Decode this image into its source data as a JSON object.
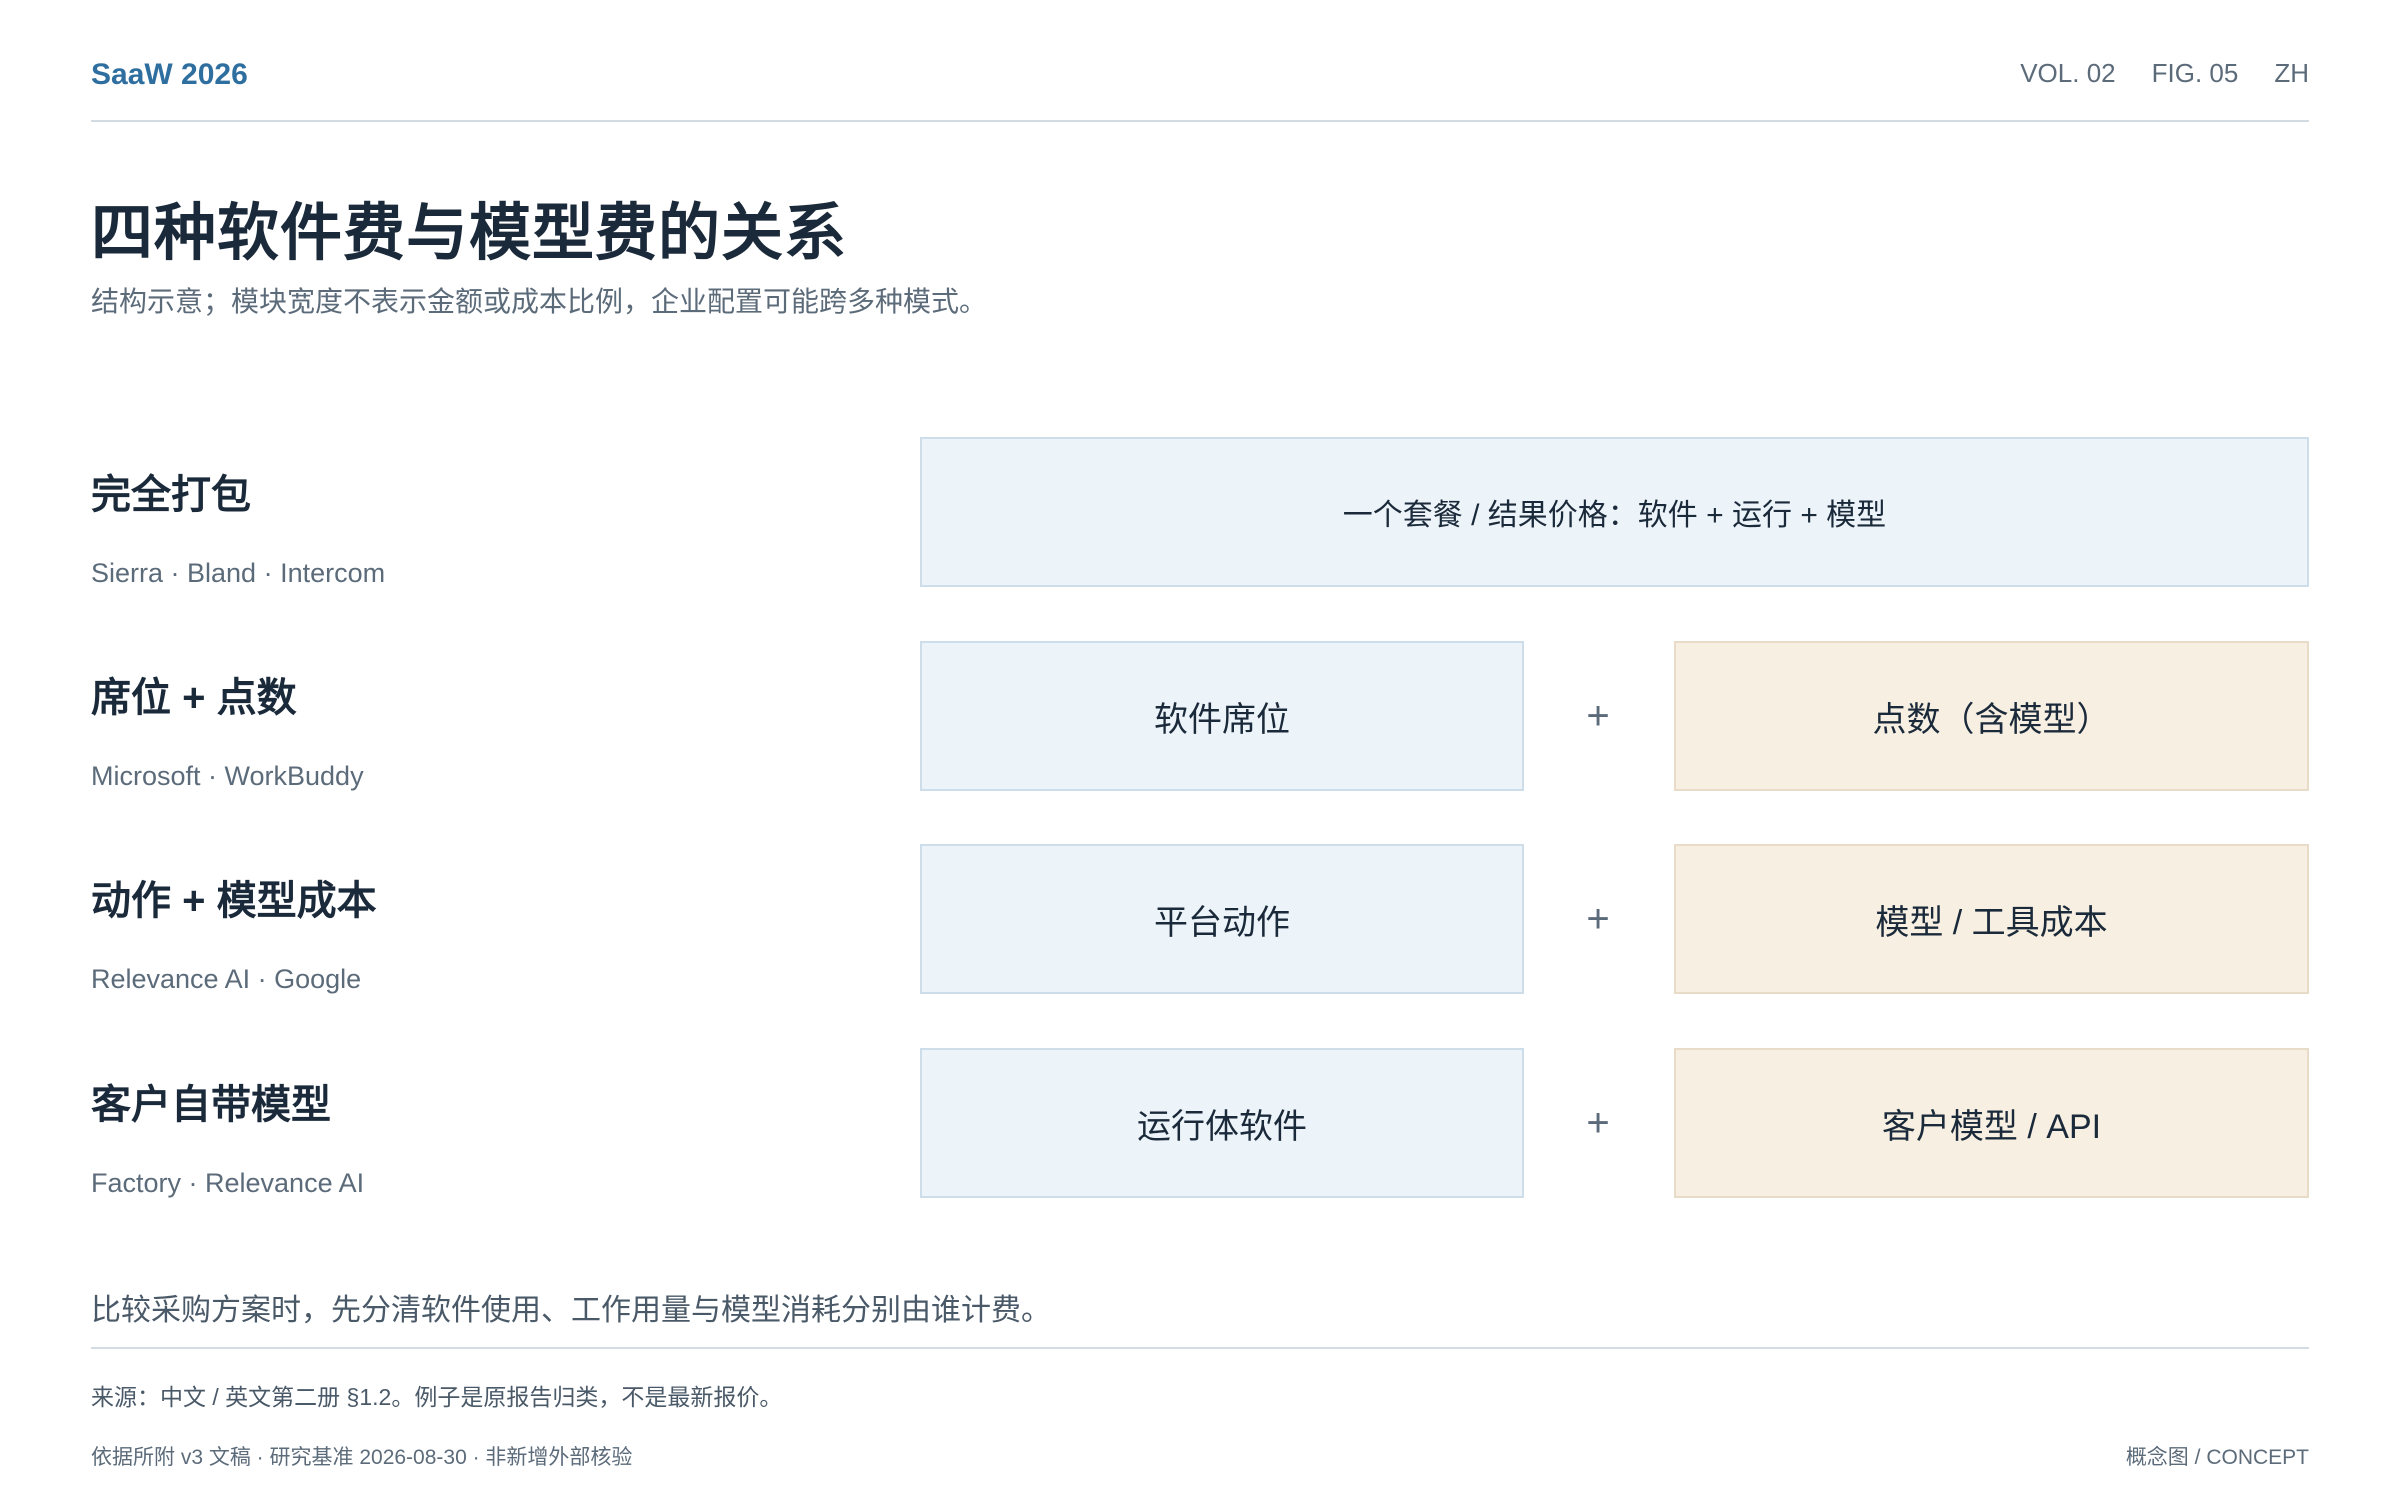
{
  "header": {
    "brand": "SaaW 2026",
    "vol": "VOL. 02",
    "fig": "FIG. 05",
    "lang": "ZH"
  },
  "title": "四种软件费与模型费的关系",
  "subtitle": "结构示意；模块宽度不表示金额或成本比例，企业配置可能跨多种模式。",
  "rows": [
    {
      "name": "完全打包",
      "examples": "Sierra · Bland · Intercom",
      "bundle": "一个套餐 / 结果价格：软件 + 运行 + 模型"
    },
    {
      "name": "席位 + 点数",
      "examples": "Microsoft · WorkBuddy",
      "software": "软件席位",
      "plus": "+",
      "model": "点数（含模型）"
    },
    {
      "name": "动作 + 模型成本",
      "examples": "Relevance AI · Google",
      "software": "平台动作",
      "plus": "+",
      "model": "模型 / 工具成本"
    },
    {
      "name": "客户自带模型",
      "examples": "Factory · Relevance AI",
      "software": "运行体软件",
      "plus": "+",
      "model": "客户模型 / API"
    }
  ],
  "note": "比较采购方案时，先分清软件使用、工作用量与模型消耗分别由谁计费。",
  "source": "来源：中文 / 英文第二册 §1.2。例子是原报告归类，不是最新报价。",
  "footer": {
    "left": "依据所附 v3 文稿 · 研究基准 2026-08-30 · 非新增外部核验",
    "right": "概念图 / CONCEPT"
  },
  "colors": {
    "brand": "#2f6f9f",
    "software_fill": "#ecf3f9",
    "model_fill": "#f7efe2",
    "text_dark": "#1b2a3a",
    "text_muted": "#5c6b7a"
  }
}
